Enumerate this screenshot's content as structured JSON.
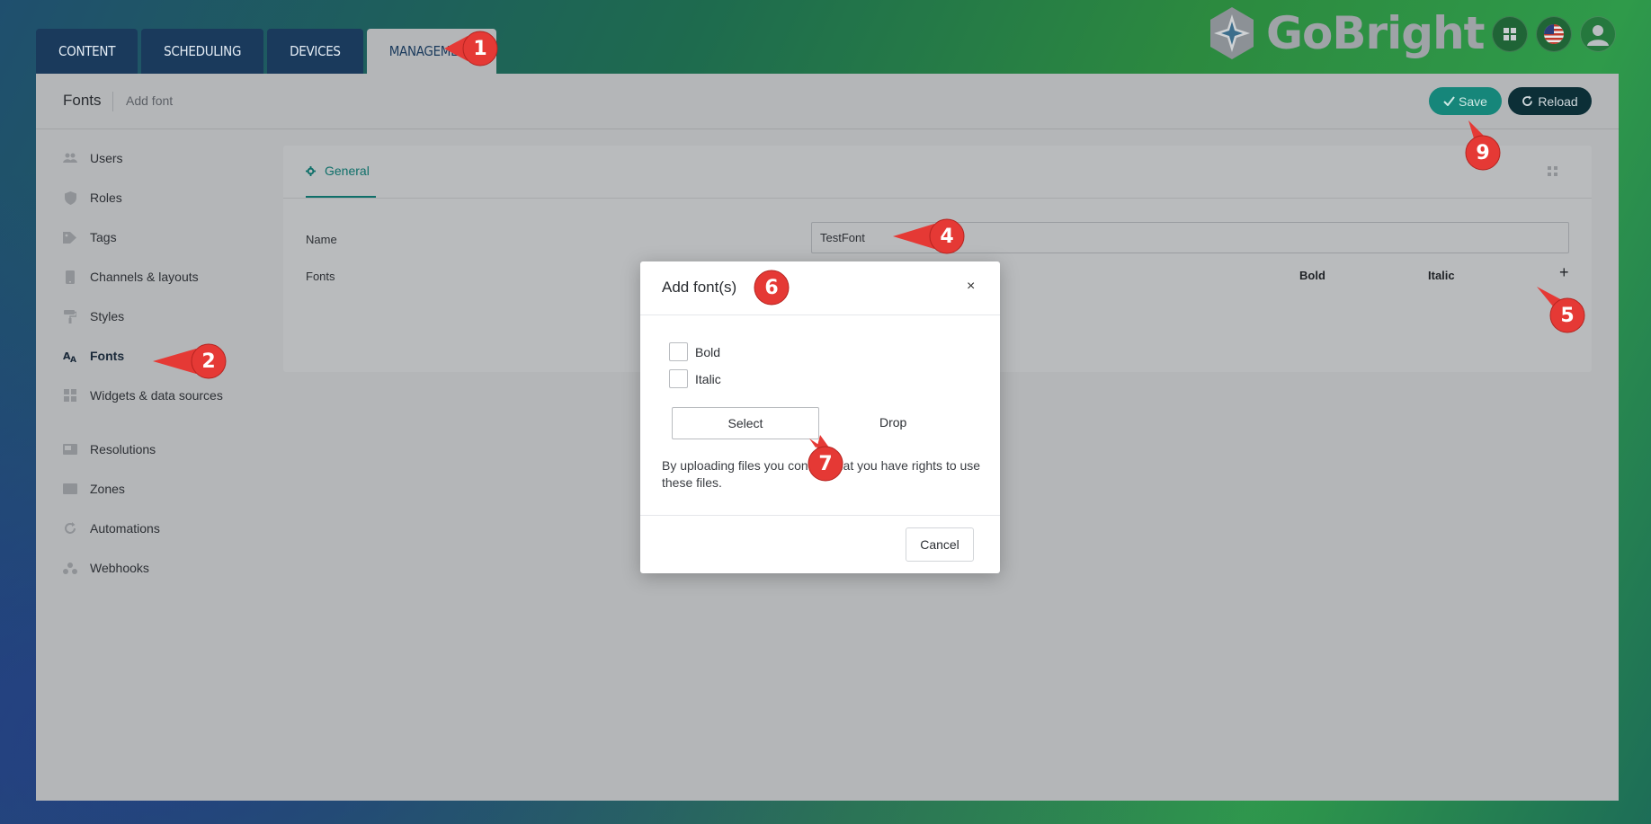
{
  "tabs": [
    {
      "label": "CONTENT",
      "active": false
    },
    {
      "label": "SCHEDULING",
      "active": false
    },
    {
      "label": "DEVICES",
      "active": false
    },
    {
      "label": "MANAGEMENT",
      "active": true
    }
  ],
  "brand": {
    "name": "GoBright"
  },
  "header": {
    "title": "Fonts",
    "subtitle": "Add font",
    "save_label": "Save",
    "reload_label": "Reload"
  },
  "sidebar": {
    "items": [
      {
        "label": "Users",
        "icon": "users-icon"
      },
      {
        "label": "Roles",
        "icon": "shield-icon"
      },
      {
        "label": "Tags",
        "icon": "tag-icon"
      },
      {
        "label": "Channels & layouts",
        "icon": "tablet-icon"
      },
      {
        "label": "Styles",
        "icon": "paint-roller-icon"
      },
      {
        "label": "Fonts",
        "icon": "font-icon",
        "active": true
      },
      {
        "label": "Widgets & data sources",
        "icon": "widgets-icon"
      },
      {
        "label": "Resolutions",
        "icon": "monitor-icon"
      },
      {
        "label": "Zones",
        "icon": "zone-icon"
      },
      {
        "label": "Automations",
        "icon": "refresh-icon"
      },
      {
        "label": "Webhooks",
        "icon": "webhook-icon"
      }
    ]
  },
  "form": {
    "tab_label": "General",
    "name_label": "Name",
    "name_value": "TestFont",
    "fonts_label": "Fonts",
    "col_bold": "Bold",
    "col_italic": "Italic",
    "add_symbol": "+"
  },
  "modal": {
    "title": "Add font(s)",
    "close_symbol": "×",
    "bold_label": "Bold",
    "italic_label": "Italic",
    "select_label": "Select",
    "drop_label": "Drop",
    "disclaimer": "By uploading files you confirm that you have rights to use these files.",
    "cancel_label": "Cancel"
  },
  "annotations": [
    "1",
    "2",
    "4",
    "5",
    "6",
    "7",
    "9"
  ],
  "colors": {
    "accent": "#16867a",
    "tab_bg": "#1a3a5c",
    "marker": "#e53935"
  }
}
